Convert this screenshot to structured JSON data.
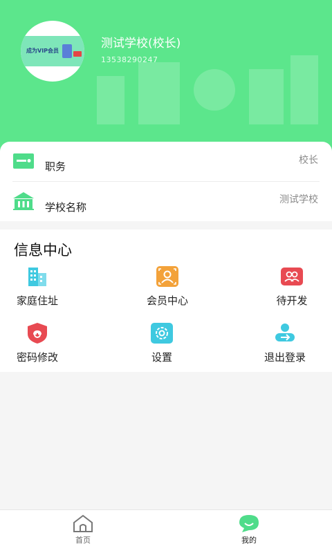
{
  "header": {
    "avatar_text": "成为VIP会员",
    "user_name": "测试学校(校长)",
    "phone": "13538290247"
  },
  "info": {
    "rows": [
      {
        "label": "职务",
        "value": "校长",
        "icon": "id-card-icon"
      },
      {
        "label": "学校名称",
        "value": "测试学校",
        "icon": "school-building-icon"
      }
    ]
  },
  "section": {
    "title": "信息中心",
    "items": [
      {
        "label": "家庭住址",
        "icon": "building-icon"
      },
      {
        "label": "会员中心",
        "icon": "member-card-icon"
      },
      {
        "label": "待开发",
        "icon": "users-icon"
      },
      {
        "label": "密码修改",
        "icon": "shield-lock-icon"
      },
      {
        "label": "设置",
        "icon": "gear-icon"
      },
      {
        "label": "退出登录",
        "icon": "logout-user-icon"
      }
    ]
  },
  "tabbar": {
    "tabs": [
      {
        "label": "首页",
        "icon": "home-icon"
      },
      {
        "label": "我的",
        "icon": "profile-chat-icon"
      }
    ]
  },
  "colors": {
    "header_green": "#5ce68c",
    "accent_green": "#4fdc8a",
    "cyan": "#3fc9e0",
    "orange": "#f3a23a",
    "red": "#e84a52"
  }
}
